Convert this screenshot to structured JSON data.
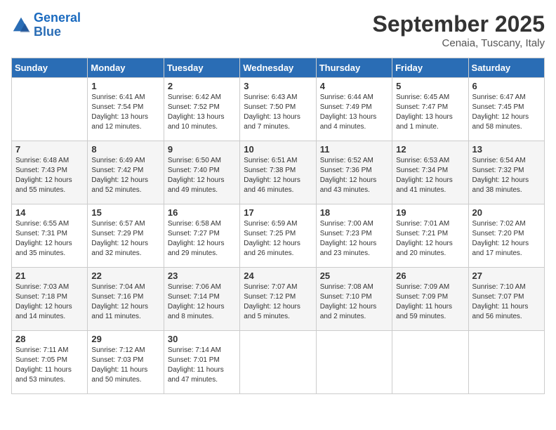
{
  "header": {
    "logo_line1": "General",
    "logo_line2": "Blue",
    "month_title": "September 2025",
    "subtitle": "Cenaia, Tuscany, Italy"
  },
  "weekdays": [
    "Sunday",
    "Monday",
    "Tuesday",
    "Wednesday",
    "Thursday",
    "Friday",
    "Saturday"
  ],
  "weeks": [
    [
      {
        "day": "",
        "info": ""
      },
      {
        "day": "1",
        "info": "Sunrise: 6:41 AM\nSunset: 7:54 PM\nDaylight: 13 hours\nand 12 minutes."
      },
      {
        "day": "2",
        "info": "Sunrise: 6:42 AM\nSunset: 7:52 PM\nDaylight: 13 hours\nand 10 minutes."
      },
      {
        "day": "3",
        "info": "Sunrise: 6:43 AM\nSunset: 7:50 PM\nDaylight: 13 hours\nand 7 minutes."
      },
      {
        "day": "4",
        "info": "Sunrise: 6:44 AM\nSunset: 7:49 PM\nDaylight: 13 hours\nand 4 minutes."
      },
      {
        "day": "5",
        "info": "Sunrise: 6:45 AM\nSunset: 7:47 PM\nDaylight: 13 hours\nand 1 minute."
      },
      {
        "day": "6",
        "info": "Sunrise: 6:47 AM\nSunset: 7:45 PM\nDaylight: 12 hours\nand 58 minutes."
      }
    ],
    [
      {
        "day": "7",
        "info": "Sunrise: 6:48 AM\nSunset: 7:43 PM\nDaylight: 12 hours\nand 55 minutes."
      },
      {
        "day": "8",
        "info": "Sunrise: 6:49 AM\nSunset: 7:42 PM\nDaylight: 12 hours\nand 52 minutes."
      },
      {
        "day": "9",
        "info": "Sunrise: 6:50 AM\nSunset: 7:40 PM\nDaylight: 12 hours\nand 49 minutes."
      },
      {
        "day": "10",
        "info": "Sunrise: 6:51 AM\nSunset: 7:38 PM\nDaylight: 12 hours\nand 46 minutes."
      },
      {
        "day": "11",
        "info": "Sunrise: 6:52 AM\nSunset: 7:36 PM\nDaylight: 12 hours\nand 43 minutes."
      },
      {
        "day": "12",
        "info": "Sunrise: 6:53 AM\nSunset: 7:34 PM\nDaylight: 12 hours\nand 41 minutes."
      },
      {
        "day": "13",
        "info": "Sunrise: 6:54 AM\nSunset: 7:32 PM\nDaylight: 12 hours\nand 38 minutes."
      }
    ],
    [
      {
        "day": "14",
        "info": "Sunrise: 6:55 AM\nSunset: 7:31 PM\nDaylight: 12 hours\nand 35 minutes."
      },
      {
        "day": "15",
        "info": "Sunrise: 6:57 AM\nSunset: 7:29 PM\nDaylight: 12 hours\nand 32 minutes."
      },
      {
        "day": "16",
        "info": "Sunrise: 6:58 AM\nSunset: 7:27 PM\nDaylight: 12 hours\nand 29 minutes."
      },
      {
        "day": "17",
        "info": "Sunrise: 6:59 AM\nSunset: 7:25 PM\nDaylight: 12 hours\nand 26 minutes."
      },
      {
        "day": "18",
        "info": "Sunrise: 7:00 AM\nSunset: 7:23 PM\nDaylight: 12 hours\nand 23 minutes."
      },
      {
        "day": "19",
        "info": "Sunrise: 7:01 AM\nSunset: 7:21 PM\nDaylight: 12 hours\nand 20 minutes."
      },
      {
        "day": "20",
        "info": "Sunrise: 7:02 AM\nSunset: 7:20 PM\nDaylight: 12 hours\nand 17 minutes."
      }
    ],
    [
      {
        "day": "21",
        "info": "Sunrise: 7:03 AM\nSunset: 7:18 PM\nDaylight: 12 hours\nand 14 minutes."
      },
      {
        "day": "22",
        "info": "Sunrise: 7:04 AM\nSunset: 7:16 PM\nDaylight: 12 hours\nand 11 minutes."
      },
      {
        "day": "23",
        "info": "Sunrise: 7:06 AM\nSunset: 7:14 PM\nDaylight: 12 hours\nand 8 minutes."
      },
      {
        "day": "24",
        "info": "Sunrise: 7:07 AM\nSunset: 7:12 PM\nDaylight: 12 hours\nand 5 minutes."
      },
      {
        "day": "25",
        "info": "Sunrise: 7:08 AM\nSunset: 7:10 PM\nDaylight: 12 hours\nand 2 minutes."
      },
      {
        "day": "26",
        "info": "Sunrise: 7:09 AM\nSunset: 7:09 PM\nDaylight: 11 hours\nand 59 minutes."
      },
      {
        "day": "27",
        "info": "Sunrise: 7:10 AM\nSunset: 7:07 PM\nDaylight: 11 hours\nand 56 minutes."
      }
    ],
    [
      {
        "day": "28",
        "info": "Sunrise: 7:11 AM\nSunset: 7:05 PM\nDaylight: 11 hours\nand 53 minutes."
      },
      {
        "day": "29",
        "info": "Sunrise: 7:12 AM\nSunset: 7:03 PM\nDaylight: 11 hours\nand 50 minutes."
      },
      {
        "day": "30",
        "info": "Sunrise: 7:14 AM\nSunset: 7:01 PM\nDaylight: 11 hours\nand 47 minutes."
      },
      {
        "day": "",
        "info": ""
      },
      {
        "day": "",
        "info": ""
      },
      {
        "day": "",
        "info": ""
      },
      {
        "day": "",
        "info": ""
      }
    ]
  ]
}
